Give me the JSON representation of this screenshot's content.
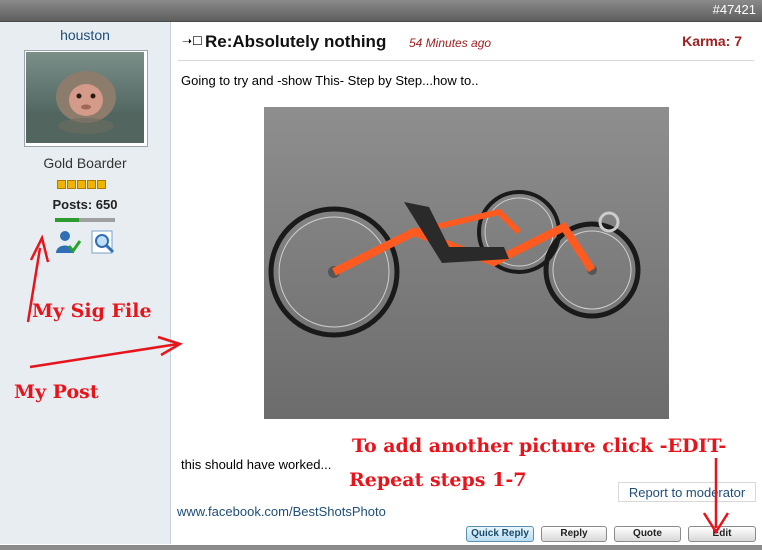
{
  "post": {
    "id_label": "#47421",
    "subject": "Re:Absolutely nothing",
    "time": "54 Minutes ago",
    "karma": "Karma: 7",
    "body_line_1": "Going to try and -show This- Step by Step...how to..",
    "body_line_2": "this should have worked...",
    "report_label": "Report to moderator",
    "signature": "www.facebook.com/BestShotsPhoto"
  },
  "author": {
    "username": "houston",
    "rank": "Gold Boarder",
    "rank_stars": 5,
    "posts": "Posts: 650",
    "activity_level": 0.4
  },
  "buttons": {
    "quick_reply": "Quick Reply",
    "reply": "Reply",
    "quote": "Quote",
    "edit": "Edit"
  },
  "annotations": {
    "sig_file": "My Sig File",
    "my_post": "My Post",
    "add_picture_prefix": "To add another picture click -",
    "add_picture_edit": "EDIT",
    "add_picture_suffix": "-",
    "repeat": "Repeat steps 1-7"
  },
  "colors": {
    "annotation_red": "#e8141c",
    "link_blue": "#1f4e79",
    "karma_red": "#a02020",
    "sidebar_bg": "#e8edf1"
  },
  "icons": [
    "post-icon",
    "profile-icon",
    "search-icon"
  ]
}
